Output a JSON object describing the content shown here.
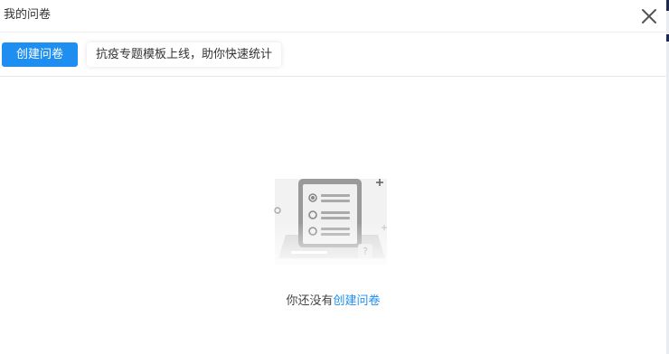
{
  "window": {
    "title": "我的问卷"
  },
  "toolbar": {
    "create_button_label": "创建问卷",
    "notice_text": "抗疫专题模板上线，助你快速统计"
  },
  "empty_state": {
    "message_prefix": "你还没有",
    "create_link_label": "创建问卷"
  },
  "colors": {
    "accent": "#1e8ff0",
    "text": "#333333",
    "border": "#e6e6e6"
  },
  "icons": {
    "close": "close-icon",
    "empty": "empty-questionnaire-icon"
  }
}
